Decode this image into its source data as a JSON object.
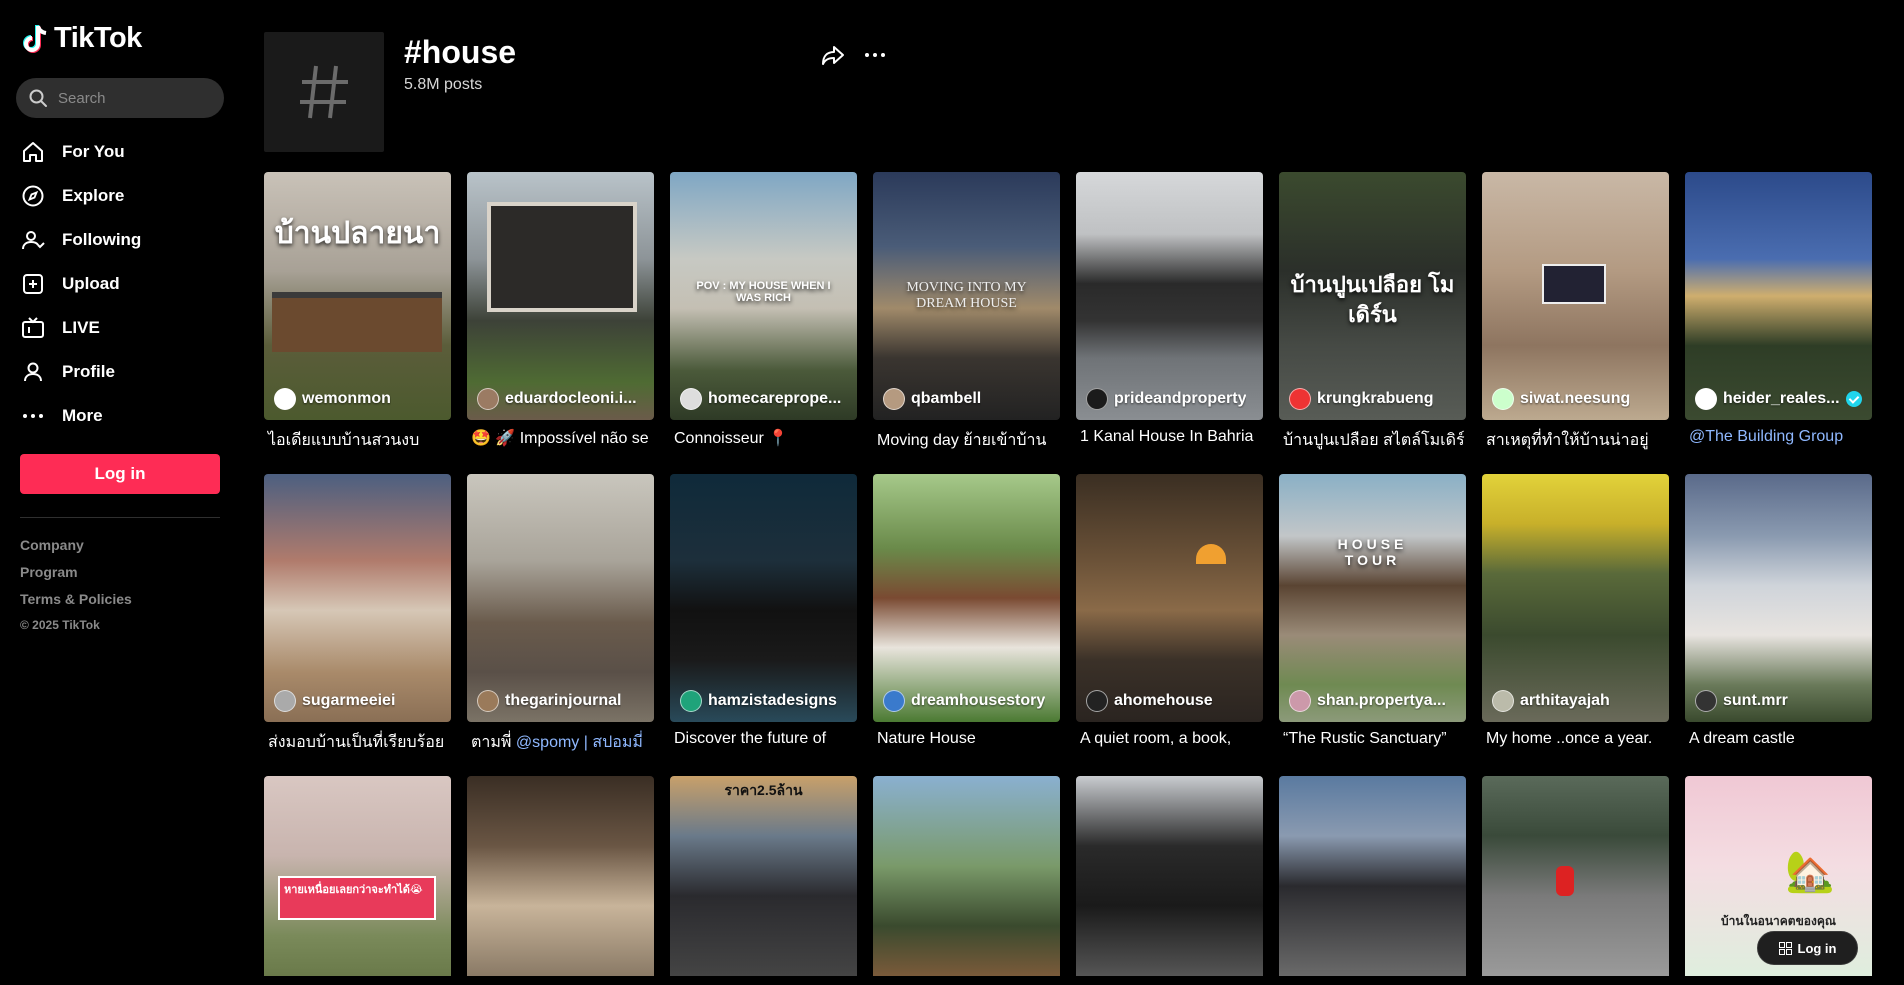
{
  "app": {
    "name": "TikTok"
  },
  "search": {
    "placeholder": "Search"
  },
  "nav": [
    {
      "label": "For You",
      "icon": "home-icon"
    },
    {
      "label": "Explore",
      "icon": "compass-icon"
    },
    {
      "label": "Following",
      "icon": "following-icon"
    },
    {
      "label": "Upload",
      "icon": "upload-icon"
    },
    {
      "label": "LIVE",
      "icon": "live-icon"
    },
    {
      "label": "Profile",
      "icon": "profile-icon"
    },
    {
      "label": "More",
      "icon": "more-dots-icon"
    }
  ],
  "login_label": "Log in",
  "footer": {
    "company": "Company",
    "program": "Program",
    "terms": "Terms & Policies",
    "copyright": "© 2025 TikTok"
  },
  "tag": {
    "title": "#house",
    "count": "5.8M posts"
  },
  "colors": {
    "accent": "#fe2c55",
    "verified": "#20d5ec",
    "mention": "#8fb8ff"
  },
  "videos_row1": [
    {
      "user": "wemonmon",
      "desc": "ไอเดียแบบบ้านสวนงบ",
      "overlay": "บ้านปลายนา"
    },
    {
      "user": "eduardocleoni.i...",
      "desc": "🤩 🚀 Impossível não se",
      "overlay": ""
    },
    {
      "user": "homecareprope...",
      "desc": "Connoisseur 📍",
      "overlay": "POV : MY HOUSE WHEN I WAS RICH"
    },
    {
      "user": "qbambell",
      "desc": "Moving day ย้ายเข้าบ้าน",
      "overlay": "MOVING INTO MY DREAM HOUSE"
    },
    {
      "user": "prideandproperty",
      "desc": "1 Kanal House In Bahria",
      "overlay": ""
    },
    {
      "user": "krungkrabueng",
      "desc": "บ้านปูนเปลือย สไตล์โมเดิร์",
      "overlay": "บ้านปูนเปลือย โมเดิร์น"
    },
    {
      "user": "siwat.neesung",
      "desc": "สาเหตุที่ทำให้บ้านน่าอยู่",
      "overlay": ""
    },
    {
      "user": "heider_reales...",
      "desc": "@The Building Group",
      "overlay": "",
      "verified": true
    }
  ],
  "videos_row2": [
    {
      "user": "sugarmeeiei",
      "desc": "ส่งมอบบ้านเป็นที่เรียบร้อย"
    },
    {
      "user": "thegarinjournal",
      "desc": "ตามพี่ ",
      "mention": "@spomy | สปอมมี่"
    },
    {
      "user": "hamzistadesigns",
      "desc": "Discover the future of"
    },
    {
      "user": "dreamhousestory",
      "desc": "Nature House"
    },
    {
      "user": "ahomehouse",
      "desc": "A quiet room, a book,"
    },
    {
      "user": "shan.propertya...",
      "desc": "“The Rustic Sanctuary”",
      "overlay": "HOUSE TOUR"
    },
    {
      "user": "arthitayajah",
      "desc": "My home ..once a year."
    },
    {
      "user": "sunt.mrr",
      "desc": "A dream castle"
    }
  ],
  "videos_row3": [
    {
      "overlay": "หายเหนื่อยเลยกว่าจะทำได้😭"
    },
    {
      "overlay": ""
    },
    {
      "overlay": "ราคา2.5ล้าน"
    },
    {
      "overlay": ""
    },
    {
      "overlay": ""
    },
    {
      "overlay": ""
    },
    {
      "overlay": ""
    },
    {
      "overlay": "บ้านในอนาคตของคุณ"
    }
  ],
  "float_login": "Log in"
}
